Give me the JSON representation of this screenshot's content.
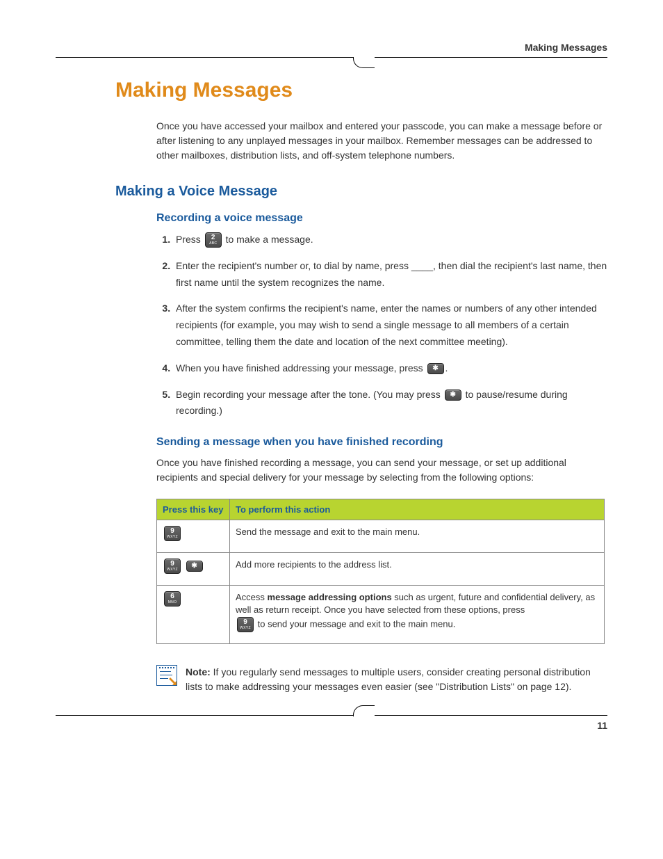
{
  "header": {
    "running_head": "Making Messages"
  },
  "chapter_title": "Making Messages",
  "intro": "Once you have accessed your mailbox and entered your passcode, you can make a message before or after listening to any unplayed messages in your mailbox. Remember messages can be addressed to other mailboxes, distribution lists, and off-system telephone numbers.",
  "section_title": "Making a Voice Message",
  "sub1_title": "Recording a voice message",
  "steps": {
    "s1a": "Press ",
    "s1_key_main": "2",
    "s1_key_sub": "ABC",
    "s1b": " to make a message.",
    "s2": "Enter the recipient's number or, to dial by name, press ____, then dial the recipient's last name, then first name until the system recognizes the name.",
    "s3": "After the system confirms the recipient's name, enter the names or numbers of any other intended recipients (for example, you may wish to send a single message to all members of a certain committee, telling them the date and location of the next committee meeting).",
    "s4a": "When you have finished addressing your message, press ",
    "s4_key": "✱",
    "s4b": ".",
    "s5a": "Begin recording your message after the tone. (You may press ",
    "s5_key": "✱",
    "s5b": " to pause/resume during recording.)"
  },
  "sub2_title": "Sending a message when you have finished recording",
  "sub2_para": "Once you have finished recording a message, you can send your message, or set up additional recipients and special delivery for your message by selecting from the following options:",
  "table": {
    "h1": "Press this key",
    "h2": "To perform this action",
    "r1_key_main": "9",
    "r1_key_sub": "WXYZ",
    "r1_action": "Send the message and exit to the main menu.",
    "r2_k1_main": "9",
    "r2_k1_sub": "WXYZ",
    "r2_k2": "✱",
    "r2_action": "Add more recipients to the address list.",
    "r3_key_main": "6",
    "r3_key_sub": "MNO",
    "r3_a": "Access ",
    "r3_bold": "message addressing options",
    "r3_b": " such as urgent, future and confidential delivery, as well as return receipt. Once you have selected from these options, press ",
    "r3_inline_key_main": "9",
    "r3_inline_key_sub": "WXYZ",
    "r3_c": " to send your message and exit to the main menu."
  },
  "note": {
    "label": "Note:",
    "text": " If you regularly send messages to multiple users, consider creating personal distribution lists to make addressing your messages even easier (see \"Distribution Lists\" on page 12)."
  },
  "page_number": "11"
}
